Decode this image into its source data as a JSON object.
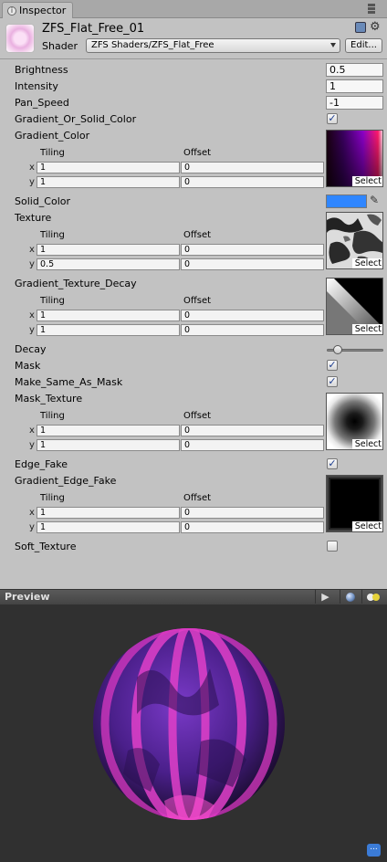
{
  "tab": {
    "title": "Inspector"
  },
  "material": {
    "name": "ZFS_Flat_Free_01",
    "shader_label": "Shader",
    "shader_value": "ZFS Shaders/ZFS_Flat_Free",
    "edit_label": "Edit..."
  },
  "props": {
    "brightness": {
      "label": "Brightness",
      "value": "0.5"
    },
    "intensity": {
      "label": "Intensity",
      "value": "1"
    },
    "pan_speed": {
      "label": "Pan_Speed",
      "value": "-1"
    },
    "gradient_or_solid": {
      "label": "Gradient_Or_Solid_Color",
      "checked": true
    },
    "gradient_color": {
      "label": "Gradient_Color",
      "tiling_x": "1",
      "tiling_y": "1",
      "offset_x": "0",
      "offset_y": "0"
    },
    "solid_color": {
      "label": "Solid_Color",
      "color": "#2f86ff"
    },
    "texture": {
      "label": "Texture",
      "tiling_x": "1",
      "tiling_y": "0.5",
      "offset_x": "0",
      "offset_y": "0"
    },
    "gradient_texture_decay": {
      "label": "Gradient_Texture_Decay",
      "tiling_x": "1",
      "tiling_y": "1",
      "offset_x": "0",
      "offset_y": "0"
    },
    "decay": {
      "label": "Decay"
    },
    "mask": {
      "label": "Mask",
      "checked": true
    },
    "make_same": {
      "label": "Make_Same_As_Mask",
      "checked": true
    },
    "mask_texture": {
      "label": "Mask_Texture",
      "tiling_x": "1",
      "tiling_y": "1",
      "offset_x": "0",
      "offset_y": "0"
    },
    "edge_fake": {
      "label": "Edge_Fake",
      "checked": true
    },
    "gradient_edge_fake": {
      "label": "Gradient_Edge_Fake",
      "tiling_x": "1",
      "tiling_y": "1",
      "offset_x": "0",
      "offset_y": "0"
    },
    "soft_texture": {
      "label": "Soft_Texture",
      "checked": false
    }
  },
  "common": {
    "tiling": "Tiling",
    "offset": "Offset",
    "x": "x",
    "y": "y",
    "select": "Select",
    "check": "✓"
  },
  "preview": {
    "title": "Preview",
    "play": "▶",
    "dots": "..."
  },
  "colors": {
    "accent": "#3b7bd6",
    "sphere_pink": "#e040c8",
    "sphere_purple": "#6a2fb8"
  }
}
